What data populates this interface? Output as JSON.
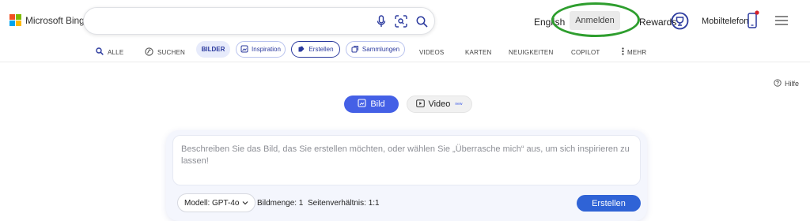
{
  "brand": {
    "name": "Microsoft Bing",
    "logo_colors": [
      "#f25022",
      "#7fba00",
      "#00a4ef",
      "#ffb900"
    ]
  },
  "search": {
    "value": "",
    "placeholder": ""
  },
  "header": {
    "language": "English",
    "signin_label": "Anmelden",
    "rewards_label": "Rewards",
    "mobile_label": "Mobiltelefon",
    "highlight_color": "#2e9e2e"
  },
  "nav": {
    "all": "ALLE",
    "search": "SUCHEN",
    "images": "BILDER",
    "inspiration": "Inspiration",
    "create": "Erstellen",
    "collections": "Sammlungen",
    "videos": "VIDEOS",
    "maps": "KARTEN",
    "news": "NEUIGKEITEN",
    "copilot": "COPILOT",
    "more": "MEHR"
  },
  "help_label": "Hilfe",
  "mode": {
    "image_label": "Bild",
    "video_label": "Video",
    "video_badge": "new",
    "accent": "#4460e6"
  },
  "prompt": {
    "placeholder": "Beschreiben Sie das Bild, das Sie erstellen möchten, oder wählen Sie „Überrasche mich“ aus, um sich inspirieren zu lassen!",
    "model_label": "Modell: GPT-4o",
    "image_count": "Bildmenge: 1",
    "aspect_ratio": "Seitenverhältnis: 1:1",
    "create_label": "Erstellen",
    "button_color": "#2f63d6"
  }
}
